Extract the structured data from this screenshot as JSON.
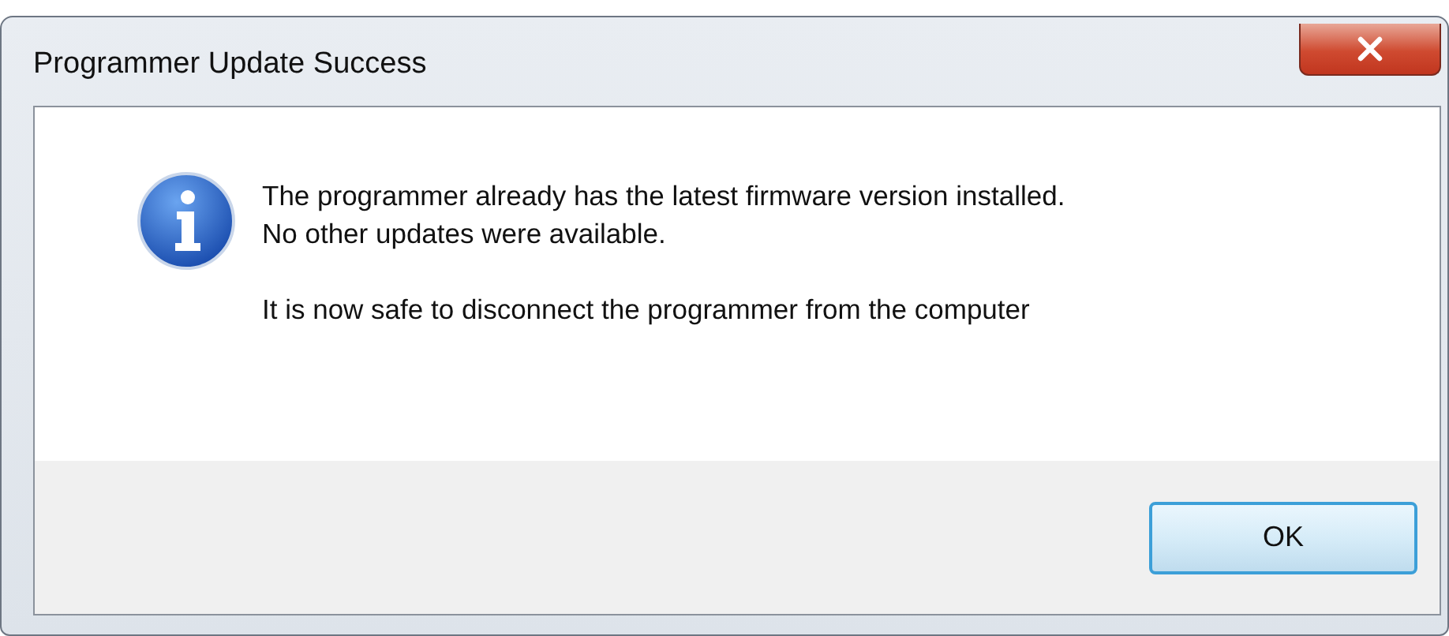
{
  "window": {
    "title": "Programmer Update Success"
  },
  "message": {
    "lines": [
      "The programmer already has the latest firmware version installed.",
      "No other updates were available."
    ],
    "note": "It is now safe to disconnect the programmer from the computer"
  },
  "buttons": [
    {
      "label": "OK",
      "focused": true
    }
  ]
}
